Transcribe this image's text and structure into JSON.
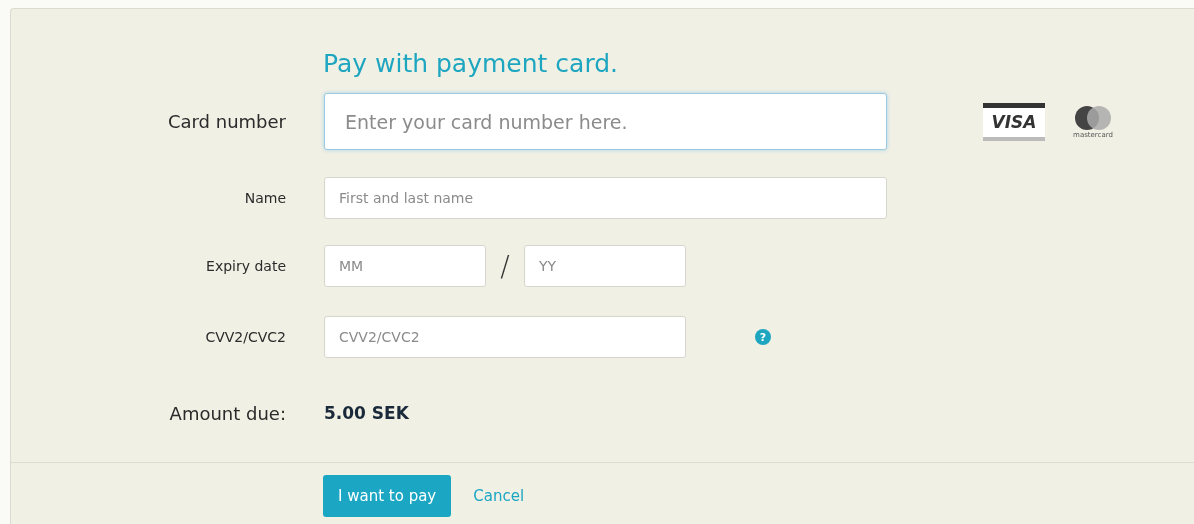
{
  "title": "Pay with payment card.",
  "card_number": {
    "label": "Card number",
    "placeholder": "Enter your card number here.",
    "focused": true
  },
  "logos": [
    {
      "kind": "visa",
      "text": "VISA"
    },
    {
      "kind": "mastercard",
      "text": "mastercard"
    }
  ],
  "name": {
    "label": "Name",
    "placeholder": "First and last name"
  },
  "expiry": {
    "label": "Expiry date",
    "month_placeholder": "MM",
    "separator": "/",
    "year_placeholder": "YY"
  },
  "cvv": {
    "label": "CVV2/CVC2",
    "placeholder": "CVV2/CVC2",
    "help": "?"
  },
  "amount": {
    "label": "Amount due:",
    "value": "5.00 SEK"
  },
  "buttons": {
    "pay": "I want to pay",
    "cancel": "Cancel"
  }
}
